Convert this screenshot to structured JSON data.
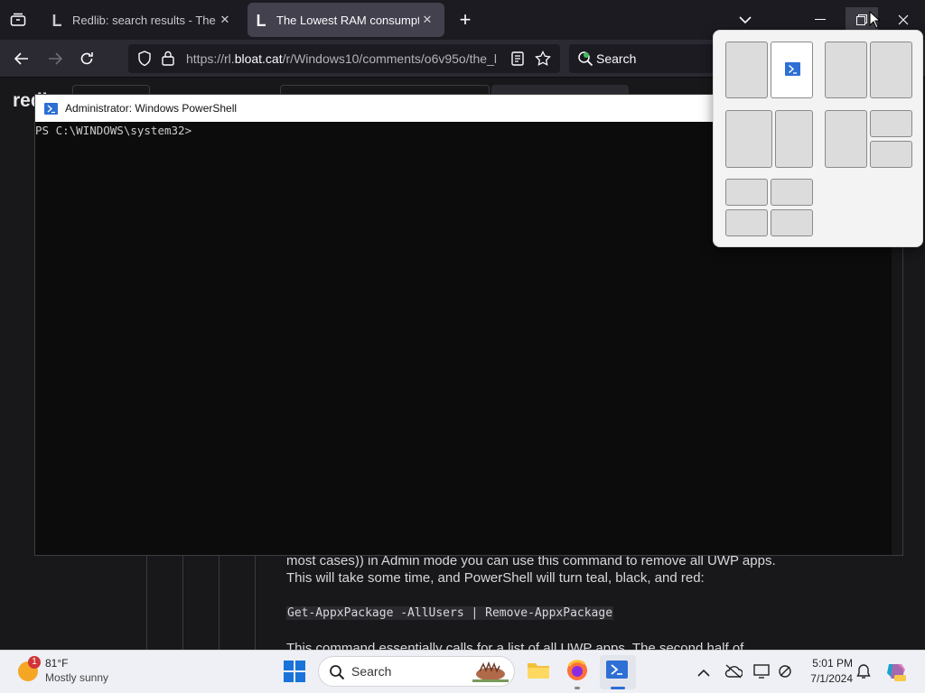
{
  "browser": {
    "tabs": [
      {
        "title": "Redlib: search results - The low",
        "active": false
      },
      {
        "title": "The Lowest RAM consumption",
        "active": true
      }
    ],
    "url_prefix": "https://rl.",
    "url_domain": "bloat.cat",
    "url_path": "/r/Windows10/comments/o6v95o/the_l",
    "search_placeholder": "Search",
    "new_tab_glyph": "+",
    "close_glyph": "✕"
  },
  "page": {
    "logo": "redl",
    "paragraph1": "most cases)) in Admin mode you can use this command to remove all UWP apps. This will take some time, and PowerShell will turn teal, black, and red:",
    "code": "Get-AppxPackage -AllUsers | Remove-AppxPackage",
    "paragraph2": "This command essentially calls for a list of all UWP apps. The second half of"
  },
  "powershell": {
    "title": "Administrator: Windows PowerShell",
    "prompt": "PS C:\\WINDOWS\\system32>"
  },
  "taskbar": {
    "weather_temp": "81°F",
    "weather_desc": "Mostly sunny",
    "weather_badge": "1",
    "search_label": "Search",
    "time": "5:01 PM",
    "date": "7/1/2024"
  },
  "colors": {
    "accent": "#2d6fd4",
    "tab_active": "#42414d",
    "toolbar": "#2b2a33",
    "terminal": "#0c0c0c"
  }
}
